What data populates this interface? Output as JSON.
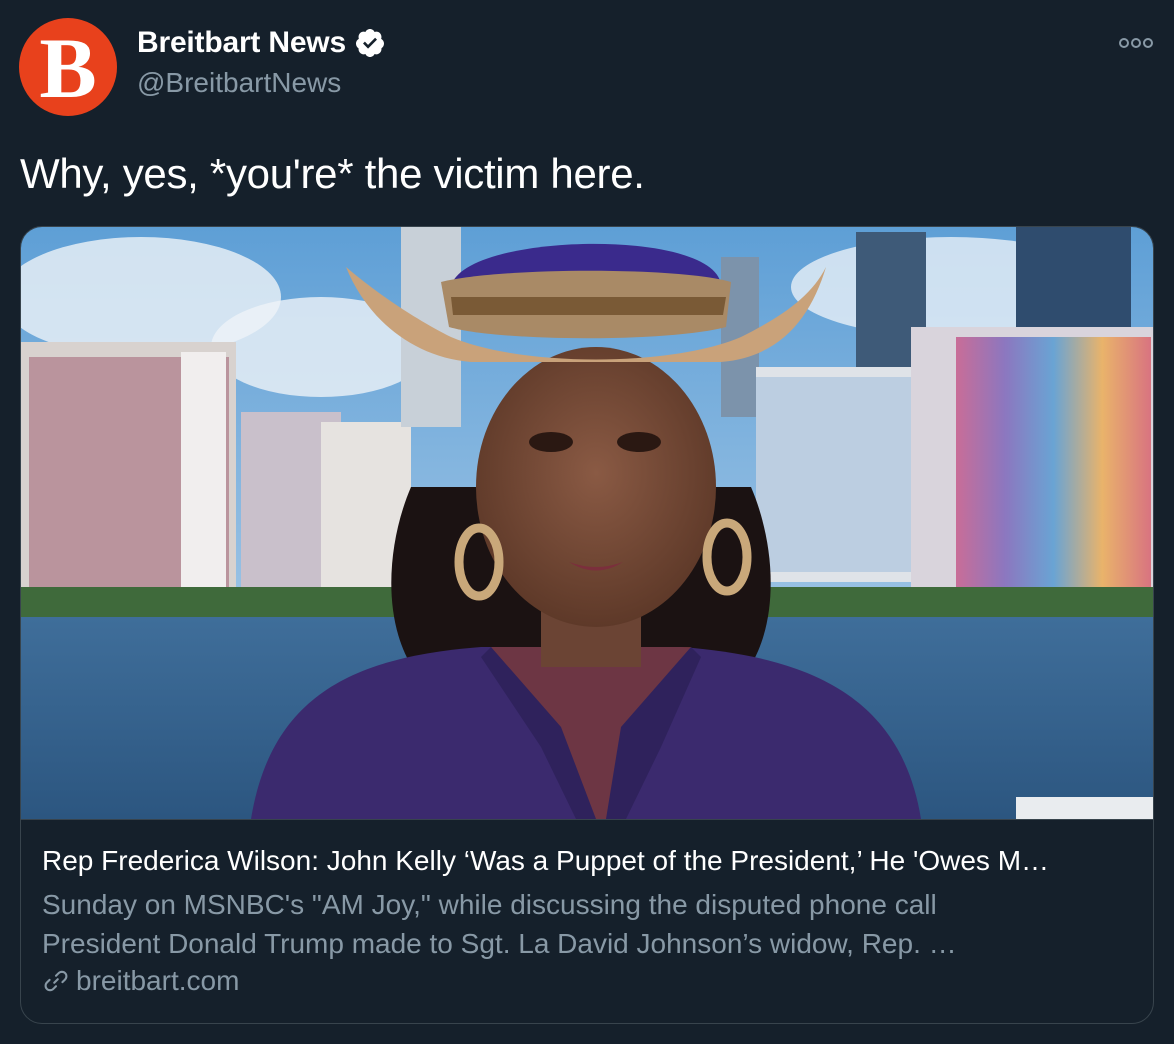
{
  "author": {
    "display_name": "Breitbart News",
    "handle": "@BreitbartNews",
    "avatar_letter": "B",
    "avatar_color": "#e8411c",
    "verified": true,
    "verified_icon": "verified-badge-icon"
  },
  "menu": {
    "icon": "more-options-icon"
  },
  "tweet": {
    "text": "Why, yes, *you're* the victim here."
  },
  "card": {
    "title": "Rep Frederica Wilson: John Kelly ‘Was a Puppet of the President,’ He 'Owes M…",
    "description_lines": [
      "Sunday on MSNBC's \"AM Joy,\" while discussing the disputed phone call",
      "President Donald Trump made to Sgt. La David Johnson’s widow, Rep. …"
    ],
    "domain": "breitbart.com",
    "link_icon": "link-icon"
  },
  "colors": {
    "background": "#15202b",
    "border": "#38444d",
    "secondary_text": "#8899a6",
    "primary_text": "#ffffff"
  }
}
